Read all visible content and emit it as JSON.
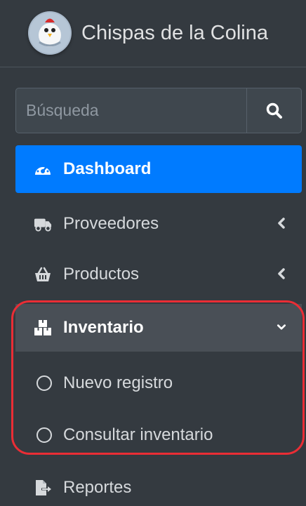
{
  "brand": {
    "title": "Chispas de la Colina",
    "logo_icon": "chicken-avatar-icon"
  },
  "search": {
    "placeholder": "Búsqueda",
    "button_icon": "search-icon"
  },
  "nav": {
    "dashboard": {
      "label": "Dashboard",
      "icon": "dashboard-icon",
      "active": true,
      "accent": "#007bff"
    },
    "proveedores": {
      "label": "Proveedores",
      "icon": "truck-icon",
      "chevron": "chevron-left-icon"
    },
    "productos": {
      "label": "Productos",
      "icon": "basket-icon",
      "chevron": "chevron-left-icon"
    },
    "inventario": {
      "label": "Inventario",
      "icon": "boxes-icon",
      "chevron": "chevron-down-icon",
      "expanded": true,
      "items": [
        {
          "label": "Nuevo registro",
          "icon": "circle-icon"
        },
        {
          "label": "Consultar inventario",
          "icon": "circle-icon"
        }
      ]
    },
    "reportes": {
      "label": "Reportes",
      "icon": "file-export-icon"
    }
  },
  "colors": {
    "sidebar_bg": "#343a40",
    "active_bg": "#007bff",
    "highlight": "#ea2d35"
  }
}
